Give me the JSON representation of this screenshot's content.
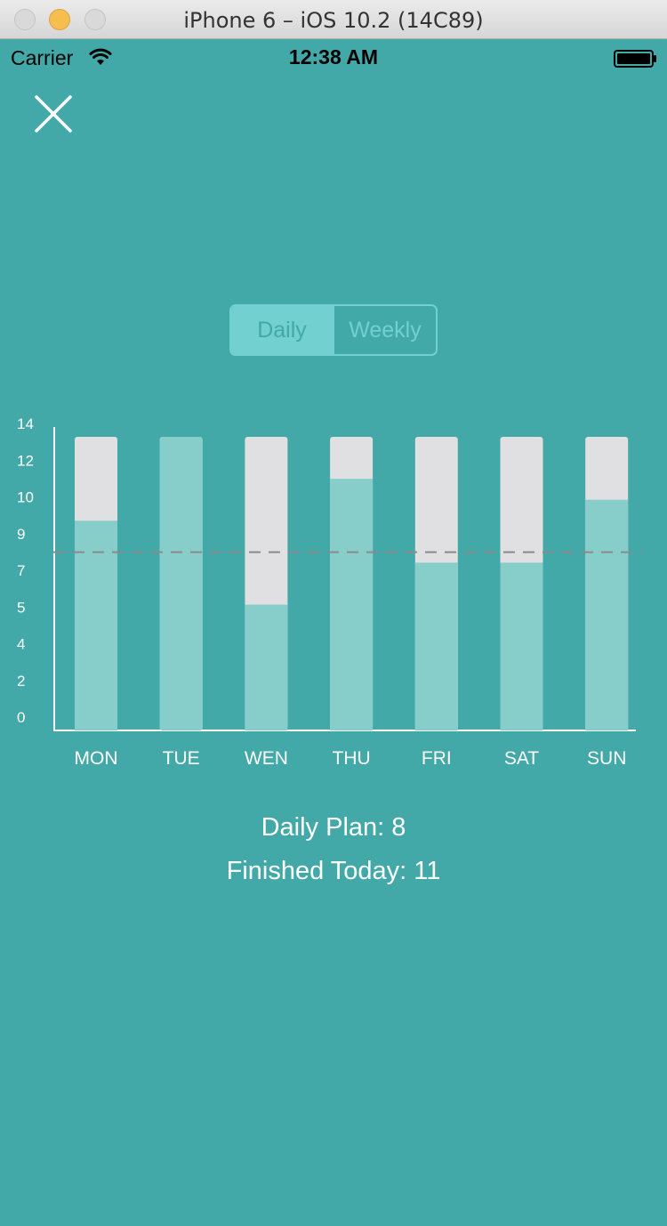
{
  "window": {
    "title": "iPhone 6 – iOS 10.2 (14C89)"
  },
  "status_bar": {
    "carrier": "Carrier",
    "time": "12:38 AM"
  },
  "segmented_control": {
    "options": [
      "Daily",
      "Weekly"
    ],
    "selected": "Daily"
  },
  "summary": {
    "plan_text": "Daily Plan: 8",
    "finished_text": "Finished Today: 11"
  },
  "colors": {
    "background": "#42a8a8",
    "bar_fill": "#87cdca",
    "bar_track": "#e0e0e2",
    "plan_line": "#8a8a8a",
    "axis": "#ffffff"
  },
  "chart_data": {
    "type": "bar",
    "categories": [
      "MON",
      "TUE",
      "WEN",
      "THU",
      "FRI",
      "SAT",
      "SUN"
    ],
    "values": [
      10,
      14,
      6,
      12,
      8,
      8,
      11
    ],
    "max_per_day": 14,
    "daily_plan": 8.5,
    "y_tick_labels": [
      "0",
      "2",
      "4",
      "5",
      "7",
      "9",
      "10",
      "12",
      "14"
    ],
    "ylim": [
      0,
      14
    ],
    "grid": false
  }
}
